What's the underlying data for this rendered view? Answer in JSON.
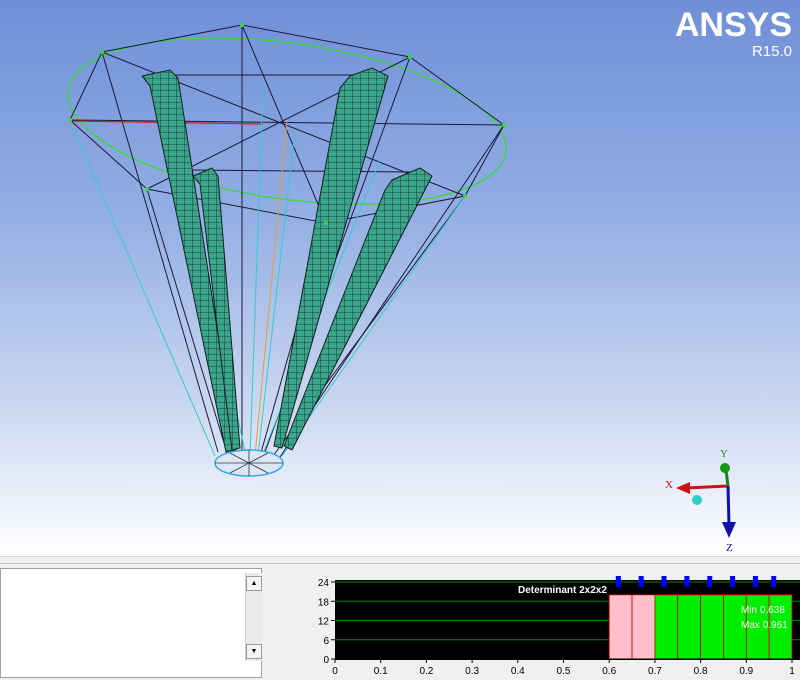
{
  "logo": {
    "brand": "ANSYS",
    "version": "R15.0"
  },
  "triad": {
    "x_label": "X",
    "y_label": "Y",
    "z_label": "Z"
  },
  "message_panel": {
    "text": ""
  },
  "scrollbar": {
    "up_glyph": "▲",
    "down_glyph": "▼"
  },
  "chart_data": {
    "type": "bar",
    "title": "Determinant 2x2x2",
    "stats": {
      "min_label": "Min",
      "min_value": "0.638",
      "max_label": "Max",
      "max_value": "0.961"
    },
    "ylim": [
      0,
      24
    ],
    "y_ticks": [
      "0",
      "6",
      "12",
      "18",
      "24"
    ],
    "xlim": [
      0,
      1
    ],
    "x_ticks": [
      "0",
      "0.1",
      "0.2",
      "0.3",
      "0.4",
      "0.5",
      "0.6",
      "0.7",
      "0.8",
      "0.9",
      "1"
    ],
    "bin_width": 0.05,
    "bins": [
      {
        "x0": 0.6,
        "value": 20,
        "color": "#ffc0cb"
      },
      {
        "x0": 0.65,
        "value": 20,
        "color": "#ffc0cb"
      },
      {
        "x0": 0.7,
        "value": 20,
        "color": "#00ee00"
      },
      {
        "x0": 0.75,
        "value": 20,
        "color": "#00ee00"
      },
      {
        "x0": 0.8,
        "value": 20,
        "color": "#00ee00"
      },
      {
        "x0": 0.85,
        "value": 20,
        "color": "#00ee00"
      },
      {
        "x0": 0.9,
        "value": 20,
        "color": "#00ee00"
      },
      {
        "x0": 0.95,
        "value": 20,
        "color": "#00ee00"
      }
    ],
    "markers_x": [
      0.62,
      0.67,
      0.72,
      0.77,
      0.82,
      0.87,
      0.92,
      0.96
    ],
    "colors": {
      "background": "#000000",
      "grid": "#008800",
      "marker": "#0000ff",
      "text": "#ffffff"
    },
    "grid": true
  }
}
